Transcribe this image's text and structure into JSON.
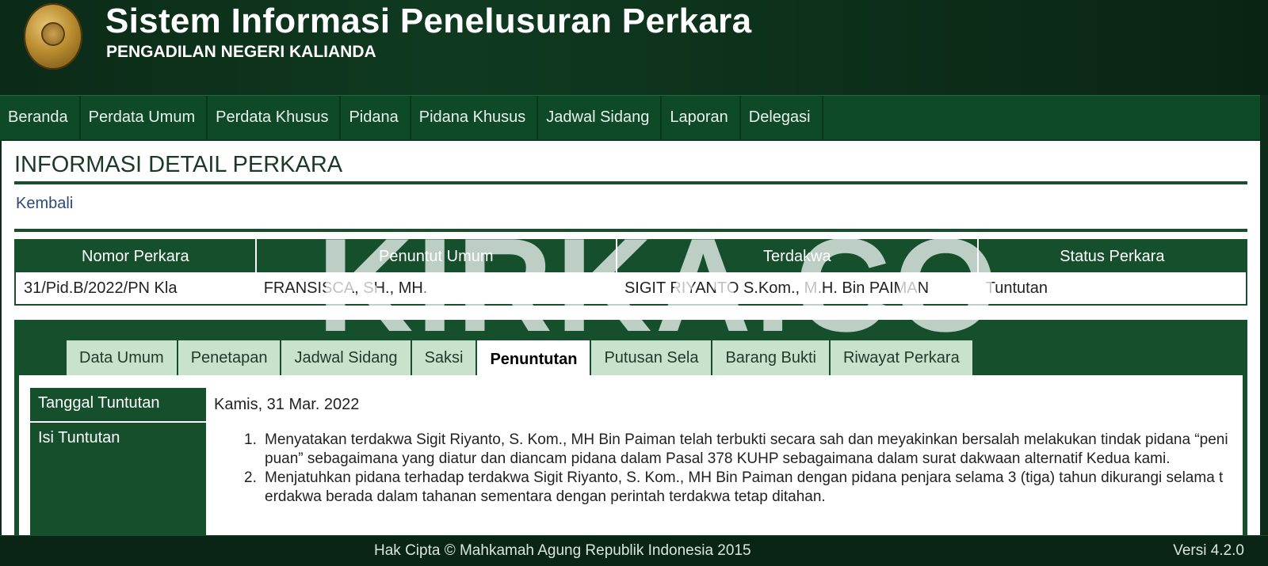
{
  "header": {
    "title": "Sistem Informasi Penelusuran Perkara",
    "subtitle": "PENGADILAN NEGERI KALIANDA",
    "logo_icon": "court-seal-icon"
  },
  "nav": {
    "items": [
      {
        "label": "Beranda"
      },
      {
        "label": "Perdata Umum"
      },
      {
        "label": "Perdata Khusus"
      },
      {
        "label": "Pidana"
      },
      {
        "label": "Pidana Khusus"
      },
      {
        "label": "Jadwal Sidang"
      },
      {
        "label": "Laporan"
      },
      {
        "label": "Delegasi"
      }
    ]
  },
  "page": {
    "title": "INFORMASI DETAIL PERKARA",
    "back_label": "Kembali"
  },
  "case_table": {
    "headers": [
      "Nomor Perkara",
      "Penuntut Umum",
      "Terdakwa",
      "Status Perkara"
    ],
    "row": [
      "31/Pid.B/2022/PN Kla",
      "FRANSISCA, SH., MH.",
      "SIGIT RIYANTO S.Kom., M.H. Bin PAIMAN",
      "Tuntutan"
    ]
  },
  "tabs": {
    "items": [
      {
        "label": "Data Umum"
      },
      {
        "label": "Penetapan"
      },
      {
        "label": "Jadwal Sidang"
      },
      {
        "label": "Saksi"
      },
      {
        "label": "Penuntutan"
      },
      {
        "label": "Putusan Sela"
      },
      {
        "label": "Barang Bukti"
      },
      {
        "label": "Riwayat Perkara"
      }
    ],
    "active": "Penuntutan"
  },
  "tuntutan": {
    "date_label": "Tanggal Tuntutan",
    "date_value": "Kamis, 31 Mar. 2022",
    "isi_label": "Isi Tuntutan",
    "items": [
      {
        "num": "1.",
        "text": "Menyatakan terdakwa Sigit Riyanto, S. Kom., MH Bin Paiman telah terbukti secara sah dan meyakinkan bersalah melakukan tindak pidana “penipuan” sebagaimana yang diatur dan diancam pidana dalam Pasal 378 KUHP sebagaimana dalam surat dakwaan alternatif Kedua kami."
      },
      {
        "num": "2.",
        "text": "Menjatuhkan pidana terhadap terdakwa Sigit Riyanto, S. Kom., MH Bin Paiman dengan pidana penjara selama 3 (tiga) tahun dikurangi selama terdakwa berada dalam tahanan sementara dengan perintah terdakwa tetap ditahan."
      }
    ]
  },
  "watermark": "KIRKA.CO",
  "footer": {
    "copyright": "Hak Cipta © Mahkamah Agung Republik Indonesia 2015",
    "version": "Versi 4.2.0"
  },
  "colors": {
    "primary_green": "#154f2c",
    "header_dark": "#0b2a17",
    "tab_inactive": "#c8e2cc",
    "link": "#2a4a7a"
  }
}
